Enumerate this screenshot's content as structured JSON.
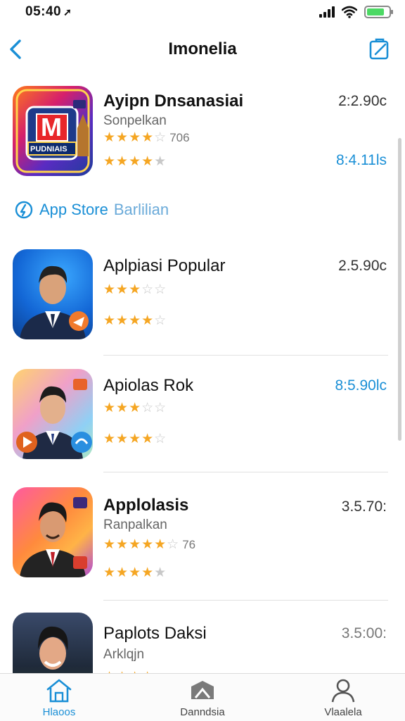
{
  "status": {
    "time": "05:40"
  },
  "nav": {
    "title": "Imonelia"
  },
  "apps": [
    {
      "name": "Ayipn Dnsanasiai",
      "subtitle": "Sonpelkan",
      "rating1_count": "706",
      "price1": "2:2.90c",
      "price2": "8:4.11ls"
    },
    {
      "name": "Aplpiasi Popular",
      "price1": "2.5.90c"
    },
    {
      "name": "Apiolas Rok",
      "price1": "8:5.90lc"
    },
    {
      "name": "Applolasis",
      "subtitle": "Ranpalkan",
      "rating1_count": "76",
      "price1": "3.5.70:"
    },
    {
      "name": "Paplots Daksi",
      "subtitle": "Arklqjn",
      "price1": "3.5:00:"
    }
  ],
  "section": {
    "label": "App Store",
    "sublabel": "Barlilian"
  },
  "featured_icon_text": {
    "big": "M",
    "small": "PUDNIAIS"
  },
  "ratings": [
    [
      4,
      4
    ],
    [
      3,
      3.5
    ],
    [
      3,
      3.5
    ],
    [
      4.5,
      4
    ],
    [
      4
    ]
  ],
  "tabs": [
    {
      "label": "Hlaoos",
      "icon": "home-icon"
    },
    {
      "label": "Danndsia",
      "icon": "books-icon"
    },
    {
      "label": "Vlaalela",
      "icon": "person-icon"
    }
  ],
  "colors": {
    "accent": "#1a8fd6",
    "star": "#f5a623"
  }
}
